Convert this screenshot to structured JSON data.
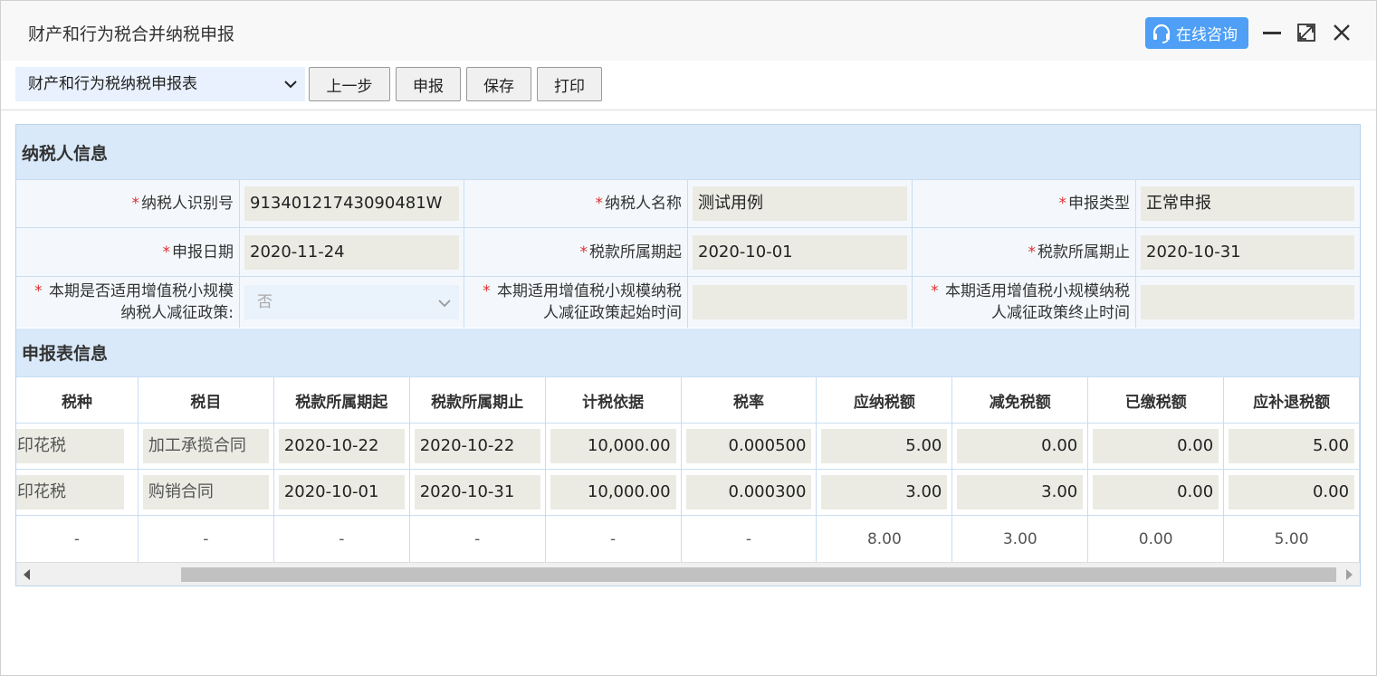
{
  "window": {
    "title": "财产和行为税合并纳税申报",
    "consult_label": "在线咨询"
  },
  "toolbar": {
    "form_select_value": "财产和行为税纳税申报表",
    "buttons": [
      "上一步",
      "申报",
      "保存",
      "打印"
    ]
  },
  "taxpayer_section": {
    "title": "纳税人信息",
    "fields": {
      "tax_id_label": "纳税人识别号",
      "tax_id_value": "91340121743090481W",
      "name_label": "纳税人名称",
      "name_value": "测试用例",
      "type_label": "申报类型",
      "type_value": "正常申报",
      "date_label": "申报日期",
      "date_value": "2020-11-24",
      "period_start_label": "税款所属期起",
      "period_start_value": "2020-10-01",
      "period_end_label": "税款所属期止",
      "period_end_value": "2020-10-31",
      "policy_label_1": "本期是否适用增值税小规模",
      "policy_label_2": "纳税人减征政策:",
      "policy_value": "否",
      "policy_start_label_1": "本期适用增值税小规模纳税",
      "policy_start_label_2": "人减征政策起始时间",
      "policy_start_value": "",
      "policy_end_label_1": "本期适用增值税小规模纳税",
      "policy_end_label_2": "人减征政策终止时间",
      "policy_end_value": ""
    }
  },
  "declaration_section": {
    "title": "申报表信息",
    "columns": [
      "税种",
      "税目",
      "税款所属期起",
      "税款所属期止",
      "计税依据",
      "税率",
      "应纳税额",
      "减免税额",
      "已缴税额",
      "应补退税额"
    ],
    "rows": [
      [
        "印花税",
        "加工承揽合同",
        "2020-10-22",
        "2020-10-22",
        "10,000.00",
        "0.000500",
        "5.00",
        "0.00",
        "0.00",
        "5.00"
      ],
      [
        "印花税",
        "购销合同",
        "2020-10-01",
        "2020-10-31",
        "10,000.00",
        "0.000300",
        "3.00",
        "3.00",
        "0.00",
        "0.00"
      ]
    ],
    "totals": [
      "-",
      "-",
      "-",
      "-",
      "-",
      "-",
      "8.00",
      "3.00",
      "0.00",
      "5.00"
    ]
  },
  "colors": {
    "accent": "#4e9ff5",
    "section_header_bg": "#d9e9f9",
    "readonly_field_bg": "#ebebe4",
    "required_star": "#e03030"
  }
}
